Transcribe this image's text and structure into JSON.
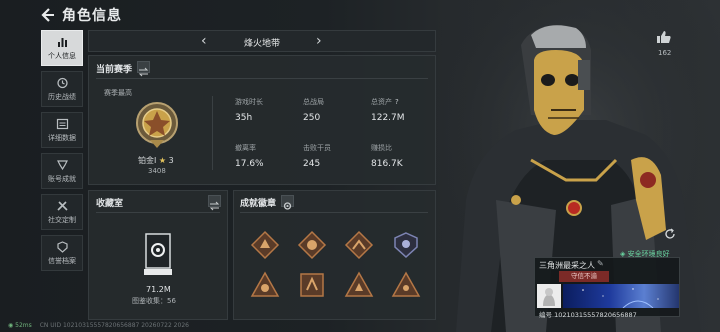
{
  "header": {
    "title": "角色信息"
  },
  "sidebar": {
    "items": [
      {
        "label": "个人信息",
        "icon": "bar-chart-icon",
        "active": true
      },
      {
        "label": "历史战绩",
        "icon": "history-icon",
        "active": false
      },
      {
        "label": "详细数据",
        "icon": "data-icon",
        "active": false
      },
      {
        "label": "账号成就",
        "icon": "achievement-icon",
        "active": false
      },
      {
        "label": "社交定制",
        "icon": "tools-icon",
        "active": false
      },
      {
        "label": "信誉档案",
        "icon": "reputation-icon",
        "active": false
      }
    ]
  },
  "map": {
    "name": "烽火地带"
  },
  "season": {
    "title": "当前赛季",
    "best_label": "赛季最高",
    "rank_name": "铂金I",
    "rank_stars": "3",
    "rank_score": "3408",
    "stats": [
      {
        "label": "游戏时长",
        "value": "35h"
      },
      {
        "label": "总战局",
        "value": "250"
      },
      {
        "label": "总资产",
        "value": "122.7M",
        "help": "?"
      },
      {
        "label": "撤离率",
        "value": "17.6%"
      },
      {
        "label": "击败干员",
        "value": "245"
      },
      {
        "label": "赚损比",
        "value": "816.7K"
      }
    ]
  },
  "vault": {
    "title": "收藏室",
    "value": "71.2M",
    "count_text": "图鉴收集：56"
  },
  "achievements": {
    "title": "成就徽章"
  },
  "profile": {
    "likes": "162",
    "safe_env": "安全环境良好",
    "player_name": "三角洲最采之人",
    "tag": "守信不渝",
    "uid": "编号 10210315557820656887"
  },
  "footer": {
    "ping": "52ms",
    "client": "CN UID 10210315557820656887 20260722 2026"
  },
  "colors": {
    "accent": "#c9a24a",
    "safe": "#69d5a0",
    "tag_bg": "#7b2a27"
  }
}
